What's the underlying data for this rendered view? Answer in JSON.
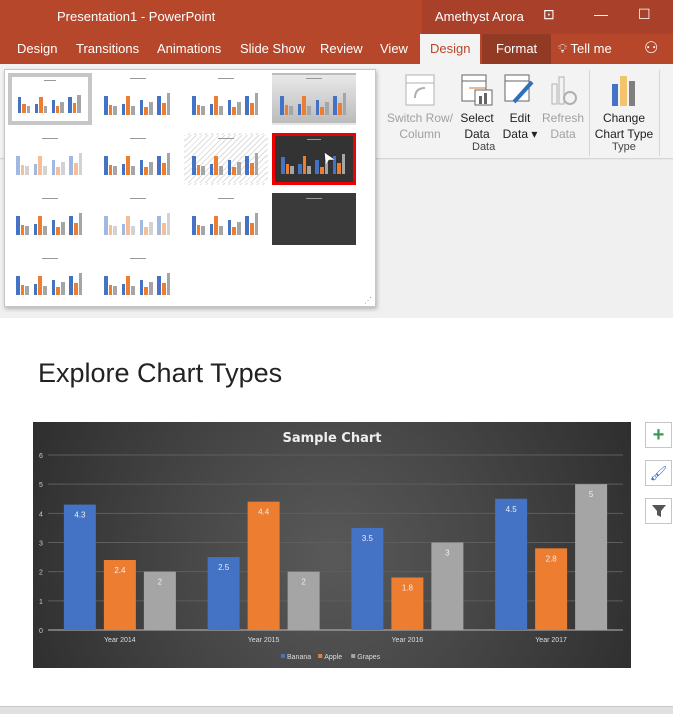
{
  "window": {
    "title": "Presentation1  -  PowerPoint",
    "user": "Amethyst Arora"
  },
  "tabs": [
    "Design",
    "Transitions",
    "Animations",
    "Slide Show",
    "Review",
    "View",
    "Design",
    "Format",
    "Tell me"
  ],
  "ribbon": {
    "buttons": [
      {
        "label1": "Switch Row/",
        "label2": "Column",
        "enabled": false
      },
      {
        "label1": "Select",
        "label2": "Data",
        "enabled": true
      },
      {
        "label1": "Edit",
        "label2": "Data ▾",
        "enabled": true
      },
      {
        "label1": "Refresh",
        "label2": "Data",
        "enabled": false
      },
      {
        "label1": "Change",
        "label2": "Chart Type",
        "enabled": true
      }
    ],
    "groups": [
      "Data",
      "Type"
    ]
  },
  "gallery": {
    "count": 14,
    "selected_index": 0,
    "hovered_index": 7
  },
  "slide": {
    "title": "Explore Chart Types"
  },
  "side_buttons": [
    "chart-elements",
    "chart-styles",
    "chart-filters"
  ],
  "chart_data": {
    "type": "bar",
    "title": "Sample Chart",
    "categories": [
      "Year 2014",
      "Year 2015",
      "Year 2016",
      "Year 2017"
    ],
    "series": [
      {
        "name": "Banana",
        "values": [
          4.3,
          2.5,
          3.5,
          4.5
        ],
        "color": "#4472c4"
      },
      {
        "name": "Apple",
        "values": [
          2.4,
          4.4,
          1.8,
          2.8
        ],
        "color": "#ed7d31"
      },
      {
        "name": "Grapes",
        "values": [
          2,
          2,
          3,
          5
        ],
        "color": "#a5a5a5"
      }
    ],
    "ylim": [
      0,
      6
    ],
    "yticks": [
      0,
      1,
      2,
      3,
      4,
      5,
      6
    ],
    "grid": true,
    "data_labels": true,
    "legend": "bottom"
  }
}
